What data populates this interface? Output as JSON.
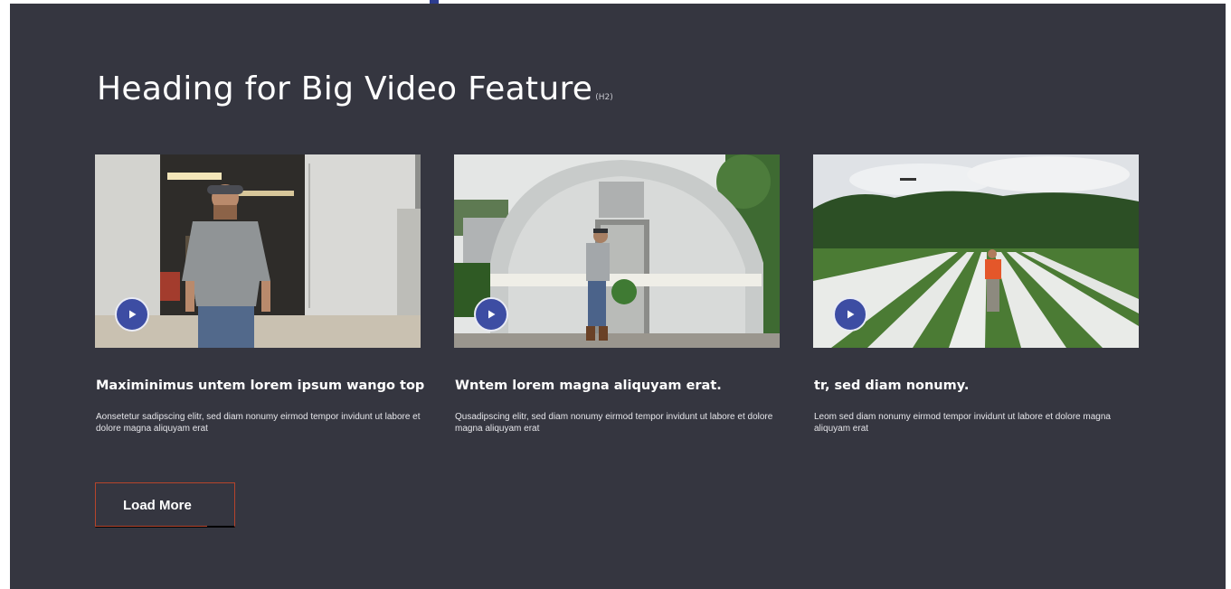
{
  "section": {
    "heading": "Heading for Big Video Feature",
    "heading_tag": "(H2)"
  },
  "cards": [
    {
      "title": "Maximinimus untem lorem ipsum wango top",
      "description": "Aonsetetur sadipscing elitr, sed diam nonumy eirmod tempor invidunt ut labore et dolore magna aliquyam erat",
      "image": "farmer-at-barn-door",
      "play_icon": "play-icon"
    },
    {
      "title": "Wntem lorem magna aliquyam erat.",
      "description": "Qusadipscing elitr, sed diam nonumy eirmod tempor invidunt ut labore et dolore magna aliquyam erat",
      "image": "man-at-greenhouse",
      "play_icon": "play-icon"
    },
    {
      "title": "tr, sed diam nonumy.",
      "description": "Leom sed diam nonumy eirmod tempor invidunt ut labore et dolore magna aliquyam erat",
      "image": "field-with-drone",
      "play_icon": "play-icon"
    }
  ],
  "actions": {
    "load_more_label": "Load More"
  },
  "colors": {
    "background": "#353640",
    "play_button": "#3d4da3",
    "button_border": "#b5442c",
    "text": "#ffffff"
  }
}
